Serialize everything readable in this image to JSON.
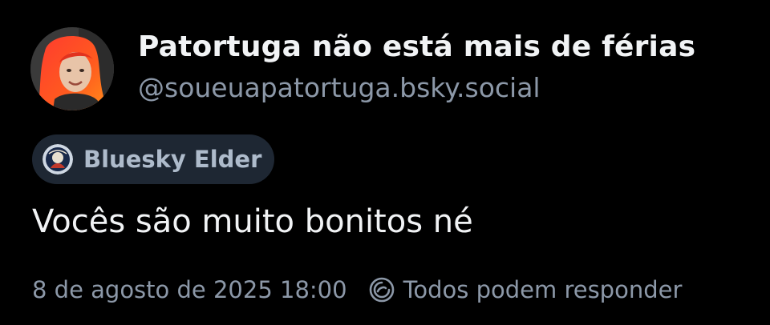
{
  "author": {
    "display_name": "Patortuga não está mais de férias",
    "handle": "@soueuapatortuga.bsky.social",
    "avatar_icon": "user-avatar-photo"
  },
  "badge": {
    "icon": "bluesky-elder-badge-icon",
    "label": "Bluesky Elder"
  },
  "post": {
    "text": "Vocês são muito bonitos né"
  },
  "meta": {
    "timestamp": "8 de agosto de 2025 18:00",
    "reply_icon": "reply-settings-icon",
    "reply_setting": "Todos podem responder"
  },
  "colors": {
    "background": "#000000",
    "primary_text": "#f1f3f5",
    "secondary_text": "#8c98a8",
    "badge_background": "#1e2733",
    "badge_text": "#aebbcb"
  }
}
